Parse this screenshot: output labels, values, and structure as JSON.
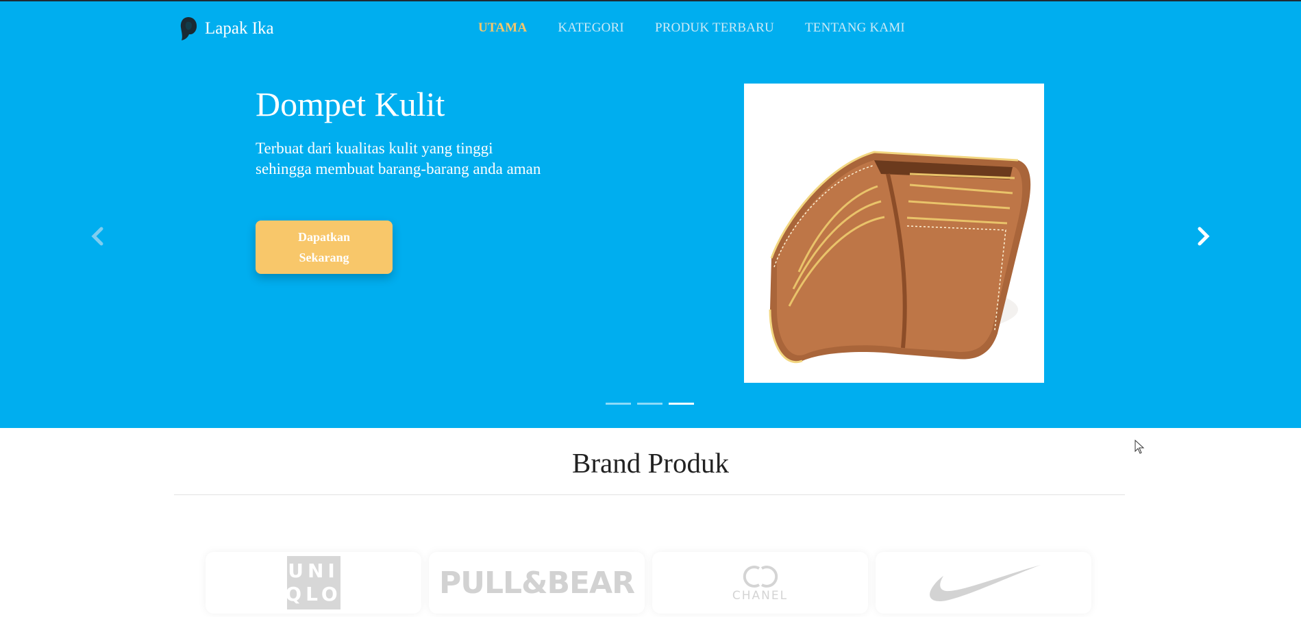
{
  "colors": {
    "hero_bg": "#00aeef",
    "accent": "#f8c76a",
    "white": "#ffffff"
  },
  "navbar": {
    "brand": "Lapak Ika",
    "brand_icon": "hijab-woman-logo-icon",
    "links": [
      {
        "label": "UTAMA",
        "active": true
      },
      {
        "label": "KATEGORI",
        "active": false
      },
      {
        "label": "PRODUK TERBARU",
        "active": false
      },
      {
        "label": "TENTANG KAMI",
        "active": false
      }
    ]
  },
  "carousel": {
    "title": "Dompet Kulit",
    "description_line1": "Terbuat dari kualitas kulit yang tinggi",
    "description_line2": "sehingga membuat barang-barang anda aman",
    "cta_line1": "Dapatkan",
    "cta_line2": "Sekarang",
    "image": "leather-wallet-photo",
    "prev_icon": "chevron-left-icon",
    "next_icon": "chevron-right-icon",
    "indicator_count": 3,
    "active_index": 3
  },
  "brands_section": {
    "title": "Brand Produk",
    "brands": [
      {
        "name": "UNIQLO",
        "line1": "UNI",
        "line2": "QLO"
      },
      {
        "name": "PULL&BEAR"
      },
      {
        "name": "CHANEL"
      },
      {
        "name": "Nike",
        "icon": "swoosh-icon"
      }
    ]
  }
}
